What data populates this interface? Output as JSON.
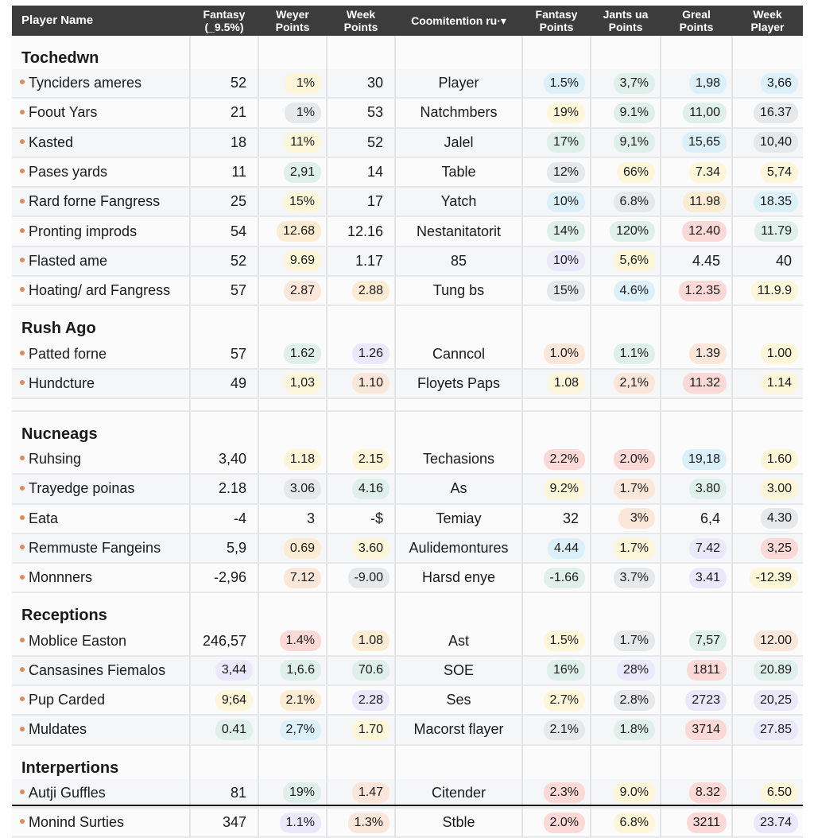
{
  "header": {
    "columns": [
      "Player Name",
      "Fantasy\n(_9.5%)",
      "Weyer\nPoints",
      "Week\nPoints",
      "Coomitention ru·▾",
      "Fantasy\nPoints",
      "Jants ua\nPoints",
      "Greal\nPoints",
      "Week\nPlayer"
    ]
  },
  "colors": {
    "header_bg": "#3c3c3c",
    "bullet": "#e08a5a",
    "pill_yellow": "#fdf6d8",
    "pill_gray": "#e6e8ea",
    "pill_green": "#dff0ea",
    "pill_blue": "#dcf0fa",
    "pill_red": "#fbd9d6",
    "pill_peach": "#fbe7da",
    "pill_purple": "#ece8fb",
    "pill_orange": "#fbecd3"
  },
  "sections": [
    {
      "title": "Tochedwn",
      "rows": [
        {
          "name": "Tynciders ameres",
          "c1": "52",
          "c2": "1%",
          "c3": "30",
          "c4": "Player",
          "c5": "1.5%",
          "c6": "3,7%",
          "c7": "1,98",
          "c8": "3,66",
          "bg": [
            "",
            "yellow",
            "",
            "",
            "blue",
            "green",
            "blue",
            "blue"
          ]
        },
        {
          "name": "Foout Yars",
          "c1": "21",
          "c2": "1%",
          "c3": "53",
          "c4": "Natchmbers",
          "c5": "19%",
          "c6": "9.1%",
          "c7": "11,00",
          "c8": "16.37",
          "bg": [
            "",
            "gray",
            "",
            "",
            "yellow",
            "green",
            "green",
            "gray"
          ]
        },
        {
          "name": "Kasted",
          "c1": "18",
          "c2": "11%",
          "c3": "52",
          "c4": "Jalel",
          "c5": "17%",
          "c6": "9,1%",
          "c7": "15,65",
          "c8": "10,40",
          "bg": [
            "",
            "yellow",
            "",
            "",
            "green",
            "green",
            "blue",
            "gray"
          ]
        },
        {
          "name": "Pases yards",
          "c1": "11",
          "c2": "2,91",
          "c3": "14",
          "c4": "Table",
          "c5": "12%",
          "c6": "66%",
          "c7": "7.34",
          "c8": "5,74",
          "bg": [
            "",
            "green",
            "",
            "",
            "gray",
            "yellow",
            "yellow",
            "yellow"
          ]
        },
        {
          "name": "Rard forne Fangress",
          "c1": "25",
          "c2": "15%",
          "c3": "17",
          "c4": "Yatch",
          "c5": "10%",
          "c6": "6.8%",
          "c7": "11.98",
          "c8": "18.35",
          "bg": [
            "",
            "yellow",
            "",
            "",
            "blue",
            "gray",
            "orange",
            "blue"
          ]
        },
        {
          "name": "Pronting improds",
          "c1": "54",
          "c2": "12.68",
          "c3": "12.16",
          "c4": "Nestanitatorit",
          "c5": "14%",
          "c6": "120%",
          "c7": "12.40",
          "c8": "11.79",
          "bg": [
            "",
            "orange",
            "",
            "",
            "green",
            "green",
            "red",
            "green"
          ]
        },
        {
          "name": "Flasted ame",
          "c1": "52",
          "c2": "9.69",
          "c3": "1.17",
          "c4": "85",
          "c5": "10%",
          "c6": "5,6%",
          "c7": "4.45",
          "c8": "40",
          "bg": [
            "",
            "yellow",
            "",
            "",
            "purple",
            "yellow",
            "",
            ""
          ]
        },
        {
          "name": "Hoating/ ard Fangress",
          "c1": "57",
          "c2": "2.87",
          "c3": "2.88",
          "c4": "Tung bs",
          "c5": "15%",
          "c6": "4.6%",
          "c7": "1.2.35",
          "c8": "11.9.9",
          "bg": [
            "",
            "peach",
            "orange",
            "",
            "gray",
            "blue",
            "red",
            "yellow"
          ]
        }
      ]
    },
    {
      "title": "Rush Ago",
      "rows": [
        {
          "name": "Patted forne",
          "c1": "57",
          "c2": "1.62",
          "c3": "1.26",
          "c4": "Canncol",
          "c5": "1.0%",
          "c6": "1.1%",
          "c7": "1.39",
          "c8": "1.00",
          "bg": [
            "",
            "green",
            "purple",
            "",
            "peach",
            "green",
            "peach",
            "yellow"
          ]
        },
        {
          "name": "Hundcture",
          "c1": "49",
          "c2": "1,03",
          "c3": "1.10",
          "c4": "Floyets Paps",
          "c5": "1.08",
          "c6": "2,1%",
          "c7": "11.32",
          "c8": "1.14",
          "bg": [
            "",
            "yellow",
            "peach",
            "",
            "yellow",
            "peach",
            "red",
            "yellow"
          ]
        }
      ],
      "gap_after": true
    },
    {
      "title": "Nucneags",
      "rows": [
        {
          "name": "Ruhsing",
          "c1": "3,40",
          "c2": "1.18",
          "c3": "2.15",
          "c4": "Techasions",
          "c5": "2.2%",
          "c6": "2.0%",
          "c7": "19,18",
          "c8": "1.60",
          "bg": [
            "",
            "yellow",
            "yellow",
            "",
            "red",
            "red",
            "blue",
            "yellow"
          ]
        },
        {
          "name": "Trayedge poinas",
          "c1": "2.18",
          "c2": "3.06",
          "c3": "4.16",
          "c4": "As",
          "c5": "9.2%",
          "c6": "1.7%",
          "c7": "3.80",
          "c8": "3.00",
          "bg": [
            "",
            "gray",
            "green",
            "",
            "yellow",
            "peach",
            "green",
            "yellow"
          ]
        },
        {
          "name": "Eata",
          "c1": "-4",
          "c2": "3",
          "c3": "-$",
          "c4": "Temiay",
          "c5": "32",
          "c6": "3%",
          "c7": "6,4",
          "c8": "4.30",
          "bg": [
            "",
            "",
            "",
            "",
            "",
            "peach",
            "",
            "gray"
          ]
        },
        {
          "name": "Remmuste Fangeins",
          "c1": "5,9",
          "c2": "0.69",
          "c3": "3.60",
          "c4": "Aulidemontures",
          "c5": "4.44",
          "c6": "1.7%",
          "c7": "7.42",
          "c8": "3,25",
          "bg": [
            "",
            "orange",
            "yellow",
            "",
            "blue",
            "yellow",
            "purple",
            "red"
          ]
        },
        {
          "name": "Monnners",
          "c1": "-2,96",
          "c2": "7.12",
          "c3": "-9.00",
          "c4": "Harsd enye",
          "c5": "-1.66",
          "c6": "3.7%",
          "c7": "3.41",
          "c8": "-12.39",
          "bg": [
            "",
            "peach",
            "gray",
            "",
            "green",
            "gray",
            "purple",
            "yellow"
          ]
        }
      ]
    },
    {
      "title": "Receptions",
      "rows": [
        {
          "name": "Moblice Easton",
          "c1": "246,57",
          "c2": "1.4%",
          "c3": "1.08",
          "c4": "Ast",
          "c5": "1.5%",
          "c6": "1.7%",
          "c7": "7,57",
          "c8": "12.00",
          "bg": [
            "",
            "red",
            "orange",
            "",
            "yellow",
            "gray",
            "green",
            "peach"
          ]
        },
        {
          "name": "Cansasines Fiemalos",
          "c1": "3,44",
          "c2": "1,6.6",
          "c3": "70.6",
          "c4": "SOE",
          "c5": "16%",
          "c6": "28%",
          "c7": "1811",
          "c8": "20.89",
          "bg": [
            "purple",
            "green",
            "green",
            "",
            "green",
            "purple",
            "red",
            "green"
          ]
        },
        {
          "name": "Pup Carded",
          "c1": "9;64",
          "c2": "2.1%",
          "c3": "2.28",
          "c4": "Ses",
          "c5": "2.7%",
          "c6": "2.8%",
          "c7": "2723",
          "c8": "20,25",
          "bg": [
            "yellow",
            "orange",
            "purple",
            "",
            "yellow",
            "gray",
            "purple",
            "purple"
          ]
        },
        {
          "name": "Muldates",
          "c1": "0.41",
          "c2": "2,7%",
          "c3": "1.70",
          "c4": "Macorst flayer",
          "c5": "2.1%",
          "c6": "1.8%",
          "c7": "3714",
          "c8": "27.85",
          "bg": [
            "green",
            "blue",
            "yellow",
            "",
            "gray",
            "green",
            "red",
            "purple"
          ]
        }
      ]
    },
    {
      "title": "Interpertions",
      "rows": [
        {
          "name": "Autji Guffles",
          "c1": "81",
          "c2": "19%",
          "c3": "1.47",
          "c4": "Citender",
          "c5": "2.3%",
          "c6": "9.0%",
          "c7": "8.32",
          "c8": "6.50",
          "bg": [
            "",
            "green",
            "peach",
            "",
            "red",
            "yellow",
            "red",
            "yellow"
          ]
        },
        {
          "name": "Monind Surties",
          "c1": "347",
          "c2": "1.1%",
          "c3": "1.3%",
          "c4": "Stble",
          "c5": "2.0%",
          "c6": "6.8%",
          "c7": "3211",
          "c8": "23.74",
          "bg": [
            "",
            "purple",
            "peach",
            "",
            "red",
            "yellow",
            "red",
            "purple"
          ]
        }
      ]
    }
  ]
}
